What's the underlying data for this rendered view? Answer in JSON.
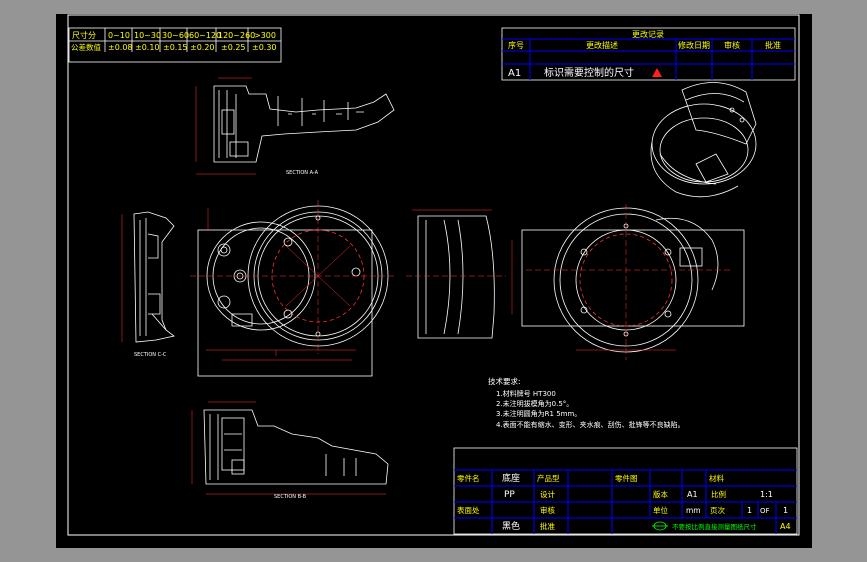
{
  "tolerance_table": {
    "headers": [
      "尺寸分",
      "0~10",
      "10~30",
      "30~60",
      "60~120",
      "120~260",
      ">300"
    ],
    "row_label": "公差数值",
    "values": [
      "±0.08",
      "±0.10",
      "±0.15",
      "±0.20",
      "±0.25",
      "±0.30"
    ]
  },
  "revision_block": {
    "title": "更改记录",
    "headers": [
      "序号",
      "更改描述",
      "修改日期",
      "审核",
      "批准"
    ],
    "row_id": "A1",
    "row_text": "标识需要控制的尺寸"
  },
  "notes": {
    "title": "技术要求:",
    "items": [
      "1.材料牌号 HT300",
      "2.未注明拔模角为0.5°。",
      "3.未注明圆角为R1 5mm。",
      "4.表面不能有缩水、变形、夹水痕、刮伤、批锋等不良缺陷。"
    ]
  },
  "section_labels": [
    "SECTION A-A",
    "SECTION B-B",
    "SECTION C-C"
  ],
  "title_block": {
    "part_name_label": "零件名",
    "part_name": "底座",
    "product_type_label": "产品型",
    "drawing_no_label": "零件图",
    "material_label": "材料",
    "material": "PP",
    "designer_label": "设计",
    "version_label": "版本",
    "version": "A1",
    "scale_label": "比例",
    "scale": "1:1",
    "surface_label": "表面处",
    "color": "黑色",
    "check_label": "审核",
    "approve_label": "批准",
    "unit_label": "单位",
    "unit": "mm",
    "page_label": "页次",
    "page": "1",
    "of_label": "OF",
    "total": "1",
    "sheet_size": "A4",
    "footer_note": "不要按比例直接测量图纸尺寸"
  },
  "colors": {
    "frame": "#ffffff",
    "table_text": "#ffff00",
    "geometry": "#ffffff",
    "dimension": "#ff3030",
    "title_block_lines": "#0000ff",
    "label_text": "#00ff00",
    "background": "#000000"
  }
}
